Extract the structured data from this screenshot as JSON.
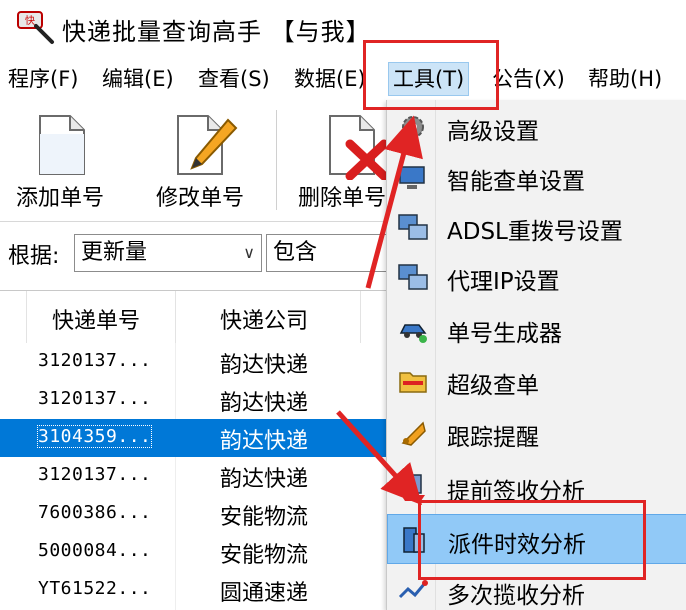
{
  "window": {
    "title": "快递批量查询高手 【与我】"
  },
  "menubar": {
    "items": [
      {
        "label": "程序(F)"
      },
      {
        "label": "编辑(E)"
      },
      {
        "label": "查看(S)"
      },
      {
        "label": "数据(E)"
      },
      {
        "label": "工具(T)"
      },
      {
        "label": "公告(X)"
      },
      {
        "label": "帮助(H)"
      }
    ]
  },
  "toolbar": {
    "add_label": "添加单号",
    "edit_label": "修改单号",
    "delete_label": "删除单号"
  },
  "filter": {
    "label": "根据:",
    "field_value": "更新量",
    "operator_value": "包含"
  },
  "list": {
    "headers": {
      "tracking_no": "快递单号",
      "carrier": "快递公司"
    },
    "rows": [
      {
        "tracking_no": "3120137...",
        "carrier": "韵达快递",
        "selected": false
      },
      {
        "tracking_no": "3120137...",
        "carrier": "韵达快递",
        "selected": false
      },
      {
        "tracking_no": "3104359...",
        "carrier": "韵达快递",
        "selected": true
      },
      {
        "tracking_no": "3120137...",
        "carrier": "韵达快递",
        "selected": false
      },
      {
        "tracking_no": "7600386...",
        "carrier": "安能物流",
        "selected": false
      },
      {
        "tracking_no": "5000084...",
        "carrier": "安能物流",
        "selected": false
      },
      {
        "tracking_no": "YT61522...",
        "carrier": "圆通速递",
        "selected": false
      }
    ]
  },
  "tools_menu": {
    "items": [
      {
        "label": "高级设置",
        "icon": "gear-icon"
      },
      {
        "label": "智能查单设置",
        "icon": "monitor-icon"
      },
      {
        "label": "ADSL重拨号设置",
        "icon": "network-icon"
      },
      {
        "label": "代理IP设置",
        "icon": "network-icon"
      },
      {
        "label": "单号生成器",
        "icon": "car-icon"
      },
      {
        "label": "超级查单",
        "icon": "folder-icon"
      },
      {
        "label": "跟踪提醒",
        "icon": "bell-icon"
      },
      {
        "label": "提前签收分析",
        "icon": "stamp-icon"
      },
      {
        "label": "派件时效分析",
        "icon": "report-icon",
        "highlighted": true
      },
      {
        "label": "多次揽收分析",
        "icon": "chart-line-icon"
      }
    ]
  },
  "colors": {
    "selection": "#0078d7",
    "menu_highlight": "#91c9f7",
    "annotation": "#e02424"
  }
}
